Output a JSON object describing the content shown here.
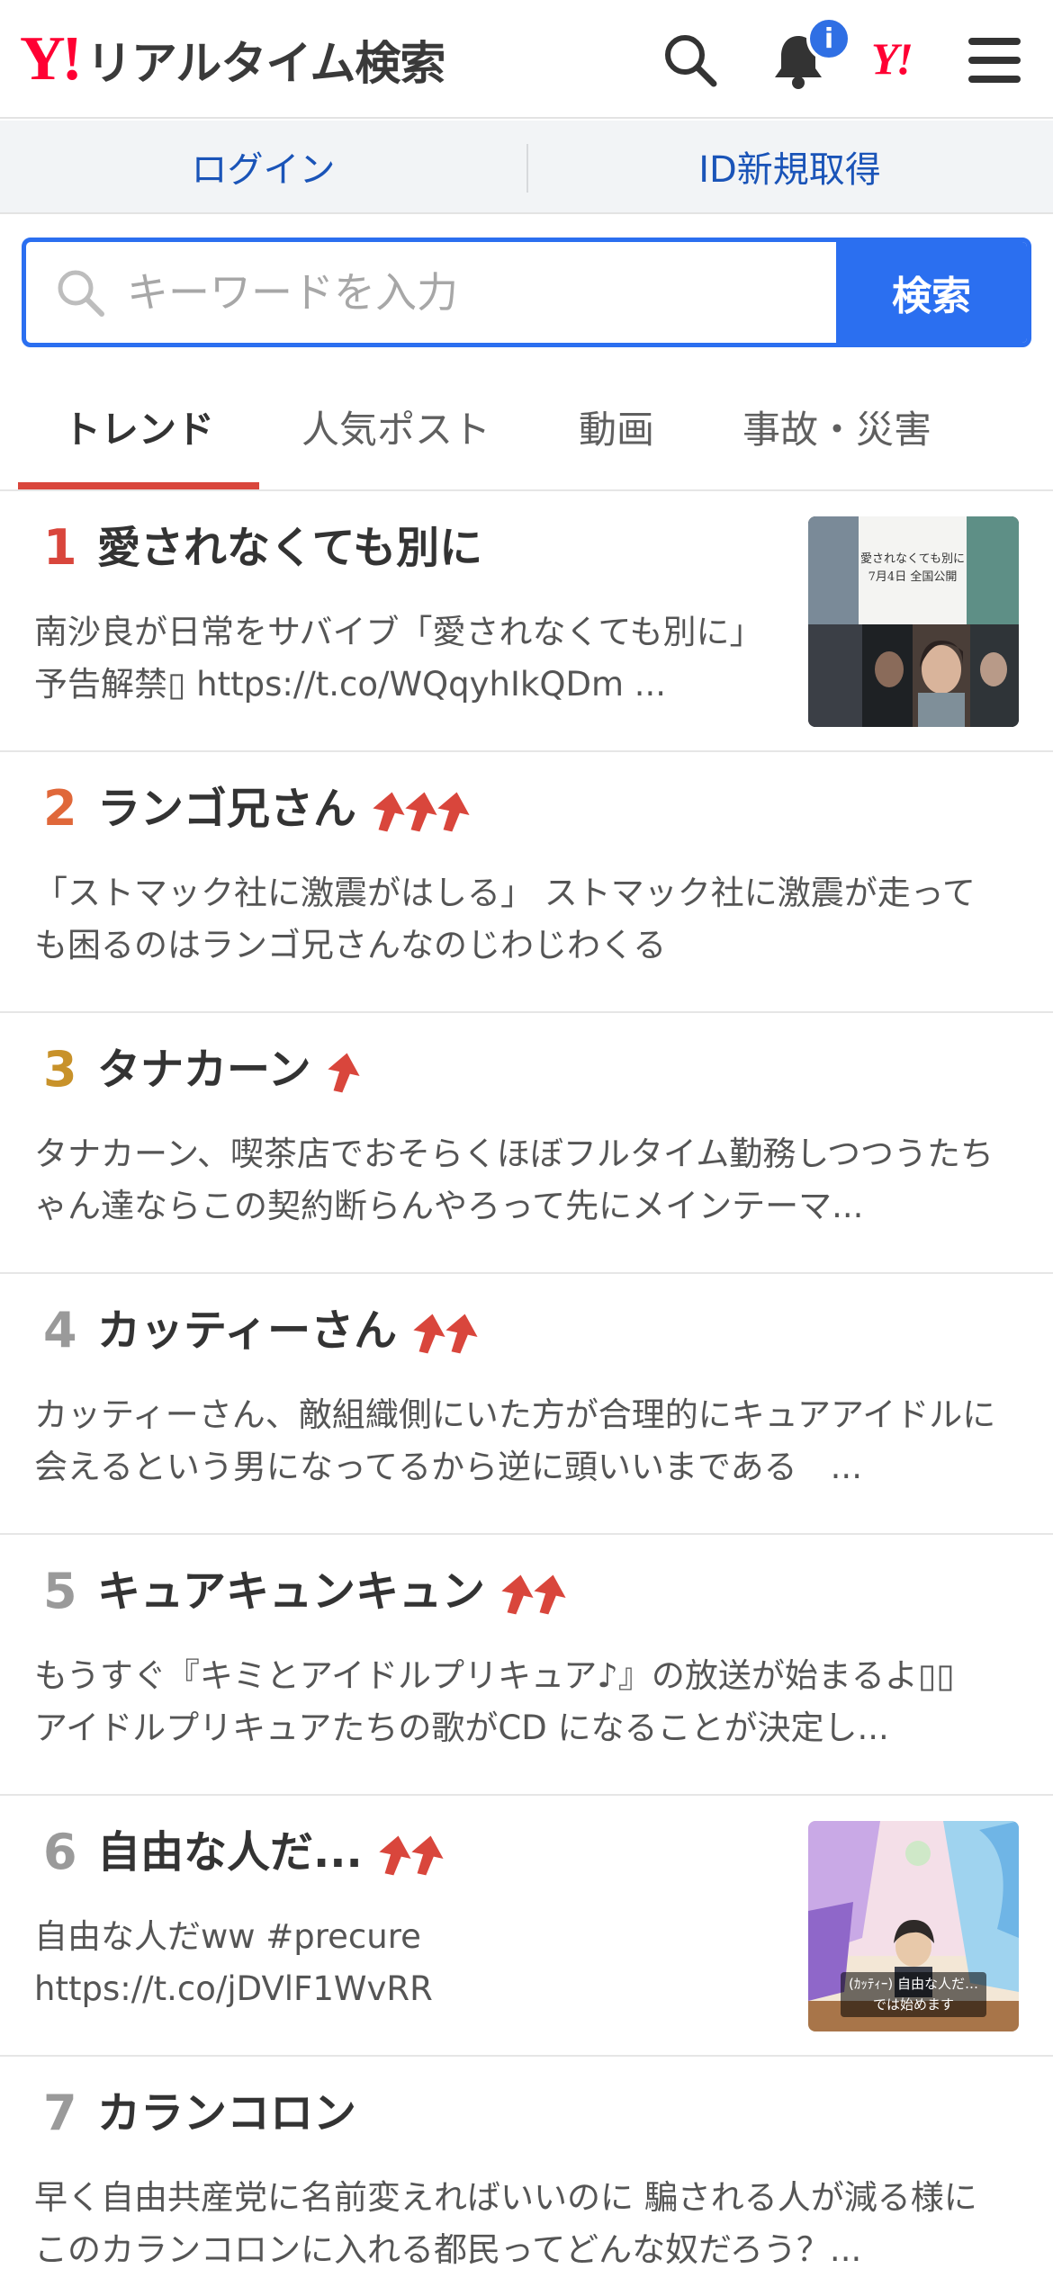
{
  "header": {
    "logo_mark": "Y!",
    "logo_text": "リアルタイム検索",
    "notification_badge": "i",
    "yahoo_mark": "Y!"
  },
  "loginbar": {
    "login": "ログイン",
    "register": "ID新規取得"
  },
  "search": {
    "placeholder": "キーワードを入力",
    "button": "検索"
  },
  "tabs": [
    {
      "label": "トレンド",
      "active": true
    },
    {
      "label": "人気ポスト"
    },
    {
      "label": "動画"
    },
    {
      "label": "事故・災害"
    }
  ],
  "trends": [
    {
      "rank": "1",
      "title": "愛されなくても別に",
      "arrows": 0,
      "desc": "南沙良が日常をサバイブ「愛されなくても別に」予告解禁▯ https://t.co/WQqyhIkQDm ...",
      "thumb": "movie-poster",
      "thumb_text": "愛されなくても別に\n7月4日 全国公開"
    },
    {
      "rank": "2",
      "title": "ランゴ兄さん",
      "arrows": 3,
      "desc": "「ストマック社に激震がはしる」 ストマック社に激震が走っても困るのはランゴ兄さんなのじわじわくる"
    },
    {
      "rank": "3",
      "title": "タナカーン",
      "arrows": 1,
      "desc": "タナカーン、喫茶店でおそらくほぼフルタイム勤務しつつうたちゃん達ならこの契約断らんやろって先にメインテーマ..."
    },
    {
      "rank": "4",
      "title": "カッティーさん",
      "arrows": 2,
      "desc": "カッティーさん、敵組織側にいた方が合理的にキュアアイドルに会えるという男になってるから逆に頭いいまである　..."
    },
    {
      "rank": "5",
      "title": "キュアキュンキュン",
      "arrows": 2,
      "desc": "もうすぐ『キミとアイドルプリキュア♪』の放送が始まるよ▯▯ アイドルプリキュアたちの歌がCD になることが決定し..."
    },
    {
      "rank": "6",
      "title": "自由な人だ...",
      "arrows": 2,
      "desc": "自由な人だww #precure https://t.co/jDVlF1WvRR",
      "thumb": "anime-screenshot",
      "thumb_text": "(ｶｯﾃｨｰ) 自由な人だ…\nでは始めます"
    },
    {
      "rank": "7",
      "title": "カランコロン",
      "arrows": 0,
      "desc": "早く自由共産党に名前変えればいいのに 騙される人が減る様に このカランコロンに入れる都民ってどんな奴だろう？..."
    }
  ],
  "colors": {
    "accent_blue": "#2b6ff0",
    "brand_red": "#ff0033",
    "rank1": "#d9463c",
    "rank2": "#e0683a",
    "rank3": "#c8922a",
    "rank_other": "#9a9a9a",
    "arrow_red": "#d9463c"
  }
}
